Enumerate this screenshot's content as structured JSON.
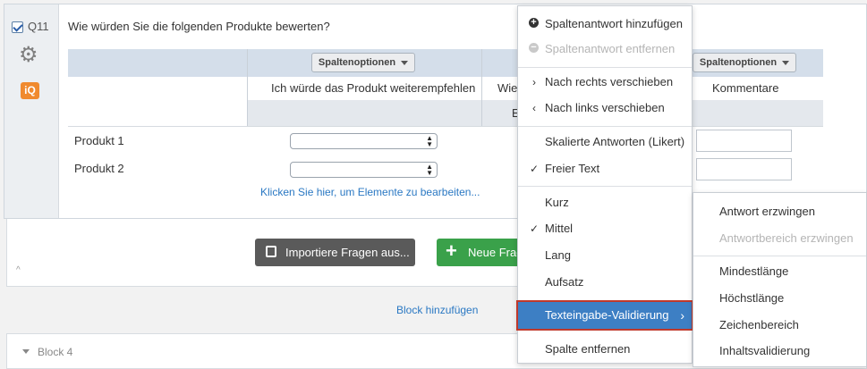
{
  "question": {
    "number": "Q11",
    "text": "Wie würden Sie die folgenden Produkte bewerten?",
    "iq_badge": "iQ"
  },
  "table": {
    "column_options_label": "Spaltenoptionen",
    "columns": [
      {
        "title": "Ich würde das Produkt weiterempfehlen"
      },
      {
        "title": "Wie",
        "sub": "E"
      },
      {
        "title": "Kommentare"
      }
    ],
    "rows": [
      {
        "label": "Produkt 1"
      },
      {
        "label": "Produkt 2"
      }
    ],
    "edit_link": "Klicken Sie hier, um Elemente zu bearbeiten..."
  },
  "actions": {
    "import_label": "Importiere Fragen aus...",
    "new_label": "Neue Frag",
    "add_block": "Block hinzufügen",
    "block4": "Block 4"
  },
  "menu": {
    "add_col": "Spaltenantwort hinzufügen",
    "remove_col": "Spaltenantwort entfernen",
    "move_right": "Nach rechts verschieben",
    "move_left": "Nach links verschieben",
    "scaled": "Skalierte Antworten (Likert)",
    "free_text": "Freier Text",
    "short": "Kurz",
    "medium": "Mittel",
    "long": "Lang",
    "essay": "Aufsatz",
    "validation": "Texteingabe-Validierung",
    "remove_column": "Spalte entfernen"
  },
  "submenu": {
    "force": "Antwort erzwingen",
    "force_range": "Antwortbereich erzwingen",
    "min_len": "Mindestlänge",
    "max_len": "Höchstlänge",
    "char_range": "Zeichenbereich",
    "content_val": "Inhaltsvalidierung"
  },
  "colors": {
    "accent": "#3d7fc4",
    "highlight_border": "#c0392b",
    "new_button": "#3aa14a",
    "import_button": "#5a5a5a",
    "iq_badge": "#f08a2e"
  }
}
